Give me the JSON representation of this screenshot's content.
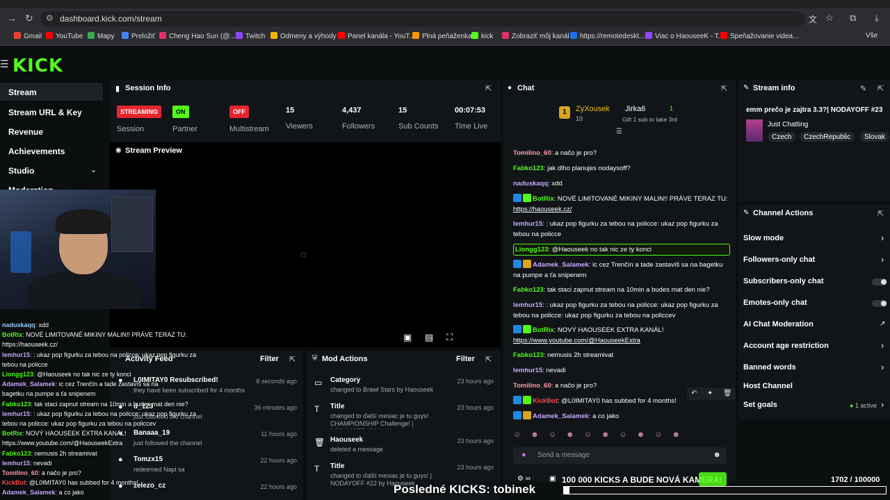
{
  "browser": {
    "url": "dashboard.kick.com/stream",
    "bookmarks": [
      "Gmail",
      "YouTube",
      "Mapy",
      "Preložiť",
      "Cheng Hao Sun (@...",
      "Twitch",
      "Odmeny a výhody",
      "Panel kanála - YouT...",
      "Plná peňaženka",
      "kick",
      "Zobraziť môj kanál",
      "https://remotedeskt...",
      "Viac o HaouseeK - T...",
      "Speňažovanie videa..."
    ],
    "more_bookmarks": "Vše"
  },
  "sidebar": {
    "items": [
      "Stream",
      "Stream URL & Key",
      "Revenue",
      "Achievements",
      "Studio",
      "Moderation"
    ]
  },
  "session": {
    "title": "Session Info",
    "streaming_badge": "STREAMING",
    "on_badge": "ON",
    "off_badge": "OFF",
    "session_label": "Session",
    "partner_label": "Partner Income",
    "multistream_label": "Multistream",
    "viewers": "15",
    "viewers_label": "Viewers",
    "followers": "4,437",
    "followers_label": "Followers",
    "subs": "15",
    "subs_label": "Sub Counts",
    "time": "00:07:53",
    "time_label": "Time Live"
  },
  "preview": {
    "title": "Stream Preview"
  },
  "overlay_chat": [
    {
      "u": "naduskaqq",
      "t": ": xdd",
      "c": "#9ad0ff"
    },
    {
      "u": "BotRix",
      "t": ": NOVÉ LIMITOVANÉ MIKINY MALIN!! PRÁVE TERAZ TU:",
      "c": "#53fc18"
    },
    {
      "u": "",
      "t": "https://haouseek.cz/",
      "c": "#fff"
    },
    {
      "u": "lemhur15",
      "t": ": : ukaz pop figurku za tebou na policce: ukaz pop figurku za",
      "c": "#c6a9ff"
    },
    {
      "u": "",
      "t": "tebou na policce",
      "c": "#fff"
    },
    {
      "u": "Liongg123",
      "t": ": @Haouseek no tak nic ze ty konci",
      "c": "#53fc18"
    },
    {
      "u": "Adamek_Salamek",
      "t": ": ic cez Trenčín a tade zastavíš sa na",
      "c": "#c6a9ff"
    },
    {
      "u": "",
      "t": "bagetku na pumpe a ťa snipenem",
      "c": "#fff"
    },
    {
      "u": "Fabko123",
      "t": ": tak staci zapnut stream na 10min a budes mat den nie?",
      "c": "#53fc18"
    },
    {
      "u": "lemhur15",
      "t": ": : ukaz pop figurku za tebou na policce: ukaz pop figurku za",
      "c": "#c6a9ff"
    },
    {
      "u": "",
      "t": "tebou na policce: ukaz pop figurku za tebou na policcev",
      "c": "#fff"
    },
    {
      "u": "BotRix",
      "t": ": NOVÝ HAOUSEEK EXTRA KANÁL!",
      "c": "#53fc18"
    },
    {
      "u": "",
      "t": "https://www.youtube.com/@HaouseekExtra",
      "c": "#fff"
    },
    {
      "u": "Fabko123",
      "t": ": nemusis 2h streamivat",
      "c": "#53fc18"
    },
    {
      "u": "lemhur15",
      "t": ": nevadi",
      "c": "#c6a9ff"
    },
    {
      "u": "Tomilino_60",
      "t": ": a načo je pro?",
      "c": "#ff9aa8"
    },
    {
      "u": "KickBot",
      "t": ": @L0IMITAY0 has subbed for 4 months!",
      "c": "#ff4a4a"
    },
    {
      "u": "Adamek_Salamek",
      "t": ": a co jako",
      "c": "#c6a9ff"
    }
  ],
  "activity": {
    "title": "Activity Feed",
    "filter": "Filter",
    "items": [
      {
        "title": "L0IMITAY0 Resubscribed!",
        "sub": "they have been subscribed for 4 months",
        "time": "8 seconds ago"
      },
      {
        "title": "d_123",
        "sub": "just followed the channel",
        "time": "36 minutes ago"
      },
      {
        "title": "Banaaa_19",
        "sub": "just followed the channel",
        "time": "11 hours ago"
      },
      {
        "title": "Tomzx15",
        "sub": "redeemed Napi sa",
        "time": "22 hours ago"
      },
      {
        "title": "zelezo_cz",
        "sub": "",
        "time": "22 hours ago"
      }
    ]
  },
  "mod": {
    "title": "Mod Actions",
    "filter": "Filter",
    "items": [
      {
        "title": "Category",
        "sub": "changed to Brawl Stars by Haouseek",
        "time": "23 hours ago"
      },
      {
        "title": "Title",
        "sub": "changed to ďalší mesiac je tu guys! CHAMPIONSHIP Challenge! | NODAYOFF #22 by Haouseek",
        "time": "23 hours ago"
      },
      {
        "title": "Haouseek",
        "sub": "deleted a message",
        "time": "23 hours ago"
      },
      {
        "title": "Title",
        "sub": "changed to ďalší mesiac je tu guys! | NODAYOFF #22 by Haouseek",
        "time": "23 hours ago"
      }
    ]
  },
  "chat": {
    "title": "Chat",
    "top_user1": "ZyXousek",
    "top_count1": "10",
    "top_user2": "Jirka6",
    "top_note": "Gift 1 sub to take 3rd",
    "top_count2": "1",
    "placeholder": "Send a message",
    "lines": [
      {
        "u": "Tomilino_60",
        "t": ": a načo je pro?",
        "c": "#ff9aa8"
      },
      {
        "u": "Fabko123",
        "t": ": jak dlho planujes nodaysoff?",
        "c": "#53fc18"
      },
      {
        "u": "naduskaqq",
        "t": ": xdd",
        "c": "#c6a9ff"
      },
      {
        "u": "BotRix",
        "t": ": NOVÉ LIMITOVANÉ MIKINY MALIN!! PRÁVE TERAZ TU:",
        "c": "#53fc18",
        "link": "https://haouseek.cz/"
      },
      {
        "u": "lemhur15",
        "t": ": : ukaz pop figurku za tebou na policce: ukaz pop figurku za tebou na policce",
        "c": "#c6a9ff"
      },
      {
        "u": "Liongg123",
        "t": ": @Haouseek no tak nic ze ty konci",
        "c": "#53fc18"
      },
      {
        "u": "Adamek_Salamek",
        "t": ": ic cez Trenčín a tade zastavíš sa na bagetku na pumpe a ťa snipenem",
        "c": "#c6a9ff"
      },
      {
        "u": "Fabko123",
        "t": ": tak staci zapnut stream na 10min a budes mat den nie?",
        "c": "#53fc18"
      },
      {
        "u": "lemhur15",
        "t": ": : ukaz pop figurku za tebou na policce: ukaz pop figurku za tebou na policce: ukaz pop figurku za tebou na policcev",
        "c": "#c6a9ff"
      },
      {
        "u": "BotRix",
        "t": ": NOVÝ HAOUSEEK EXTRA KANÁL!",
        "c": "#53fc18",
        "link": "https://www.youtube.com/@HaouseekExtra"
      },
      {
        "u": "Fabko123",
        "t": ": nemusis 2h streamivat",
        "c": "#53fc18"
      },
      {
        "u": "lemhur15",
        "t": ": nevadi",
        "c": "#c6a9ff"
      },
      {
        "u": "Tomilino_60",
        "t": ": a načo je pro?",
        "c": "#ff9aa8"
      },
      {
        "u": "KickBot",
        "t": ": @L0IMITAY0 has subbed for 4 months!",
        "c": "#ff4a4a"
      },
      {
        "u": "Adamek_Salamek",
        "t": ": a co jako",
        "c": "#c6a9ff"
      }
    ]
  },
  "stream_info": {
    "title": "Stream info",
    "stream_title": "emm prečo je zajtra 3.3?| NODAYOFF #23",
    "category": "Just Chatting",
    "tags": [
      "Czech",
      "CzechRepublic",
      "Slovak"
    ]
  },
  "channel_actions": {
    "title": "Channel Actions",
    "items": [
      "Slow mode",
      "Followers-only chat",
      "Subscribers-only chat",
      "Emotes-only chat",
      "AI Chat Moderation",
      "Account age restriction",
      "Banned words",
      "Host Channel",
      "Set goals"
    ],
    "goals_note": "1 active"
  },
  "goal": {
    "text": "100 000 KICKS A BUDE NOVÁ KAMERA!",
    "progress": "1702 / 100000",
    "progress_fraction": 0.017,
    "last": "Posledné KICKS: tobinek"
  },
  "colors": {
    "accent": "#53fc18",
    "live": "#e5262f"
  }
}
